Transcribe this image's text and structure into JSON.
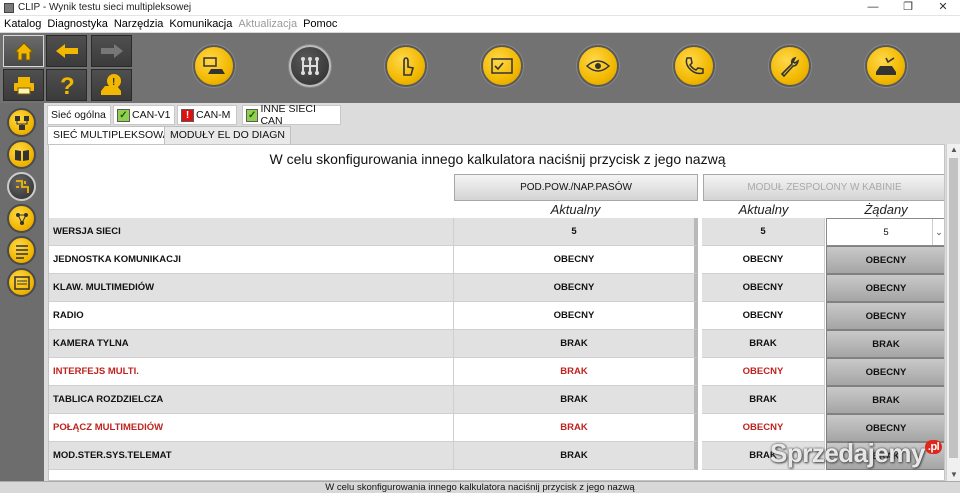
{
  "window": {
    "title": "CLIP - Wynik testu sieci multipleksowej",
    "controls": {
      "minimize": "—",
      "restore": "❐",
      "close": "✕"
    }
  },
  "menu": [
    {
      "label": "Katalog",
      "enabled": true
    },
    {
      "label": "Diagnostyka",
      "enabled": true
    },
    {
      "label": "Narzędzia",
      "enabled": true
    },
    {
      "label": "Komunikacja",
      "enabled": true
    },
    {
      "label": "Aktualizacja",
      "enabled": false
    },
    {
      "label": "Pomoc",
      "enabled": true
    }
  ],
  "toolbar": {
    "nav_icons": [
      "home-icon",
      "back-arrow-icon",
      "forward-arrow-icon",
      "print-icon",
      "help-icon",
      "vehicle-info-icon"
    ],
    "round_icons": [
      "vehicle-ecu-icon",
      "gearbox-icon",
      "touch-icon",
      "checklist-icon",
      "eye-icon",
      "phone-support-icon",
      "wrench-icon",
      "vehicle-check-icon"
    ]
  },
  "sidebar": {
    "icons": [
      "network-diagram-icon",
      "book-icon",
      "wiring-icon",
      "graph-icon",
      "list-icon",
      "document-icon"
    ]
  },
  "network_tabs": {
    "label": "Sieć ogólna",
    "items": [
      {
        "label": "CAN-V1",
        "status": "ok"
      },
      {
        "label": "CAN-M",
        "status": "error"
      },
      {
        "label": "INNE SIECI CAN",
        "status": "ok"
      }
    ],
    "status_symbols": {
      "ok": "✓",
      "error": "!"
    }
  },
  "sub_tabs": [
    {
      "label": "SIEĆ MULTIPLEKSOWA",
      "active": true
    },
    {
      "label": "MODUŁY EL DO DIAGN",
      "active": false
    }
  ],
  "instruction": "W celu skonfigurowania innego kalkulatora naciśnij przycisk z jego nazwą",
  "column_buttons": {
    "left": {
      "label": "POD.POW./NAP.PASÓW",
      "enabled": true
    },
    "right": {
      "label": "MODUŁ ZESPOLONY W KABINIE",
      "enabled": false
    }
  },
  "column_headers": {
    "actual_left": "Aktualny",
    "actual_right": "Aktualny",
    "required": "Żądany"
  },
  "rows": [
    {
      "name": "WERSJA SIECI",
      "actual1": "5",
      "actual2": "5",
      "required": "5",
      "mismatch": false
    },
    {
      "name": "JEDNOSTKA KOMUNIKACJI",
      "actual1": "OBECNY",
      "actual2": "OBECNY",
      "required": "OBECNY",
      "mismatch": false
    },
    {
      "name": "KLAW. MULTIMEDIÓW",
      "actual1": "OBECNY",
      "actual2": "OBECNY",
      "required": "OBECNY",
      "mismatch": false
    },
    {
      "name": "RADIO",
      "actual1": "OBECNY",
      "actual2": "OBECNY",
      "required": "OBECNY",
      "mismatch": false
    },
    {
      "name": "KAMERA TYLNA",
      "actual1": "BRAK",
      "actual2": "BRAK",
      "required": "BRAK",
      "mismatch": false
    },
    {
      "name": "INTERFEJS MULTI.",
      "actual1": "BRAK",
      "actual2": "OBECNY",
      "required": "OBECNY",
      "mismatch": true
    },
    {
      "name": "TABLICA ROZDZIELCZA",
      "actual1": "BRAK",
      "actual2": "BRAK",
      "required": "BRAK",
      "mismatch": false
    },
    {
      "name": "POŁĄCZ MULTIMEDIÓW",
      "actual1": "BRAK",
      "actual2": "OBECNY",
      "required": "OBECNY",
      "mismatch": true
    },
    {
      "name": "MOD.STER.SYS.TELEMAT",
      "actual1": "BRAK",
      "actual2": "BRAK",
      "required": "BRAK",
      "mismatch": false
    }
  ],
  "status_bar": "W celu skonfigurowania innego kalkulatora naciśnij przycisk z jego nazwą",
  "watermark": {
    "text": "Sprzedajemy",
    "suffix": ".pl"
  },
  "colors": {
    "toolbar_bg": "#727272",
    "accent_yellow": "#f2b800",
    "mismatch_red": "#c0221e",
    "panel_grey": "#dcdcdc"
  }
}
